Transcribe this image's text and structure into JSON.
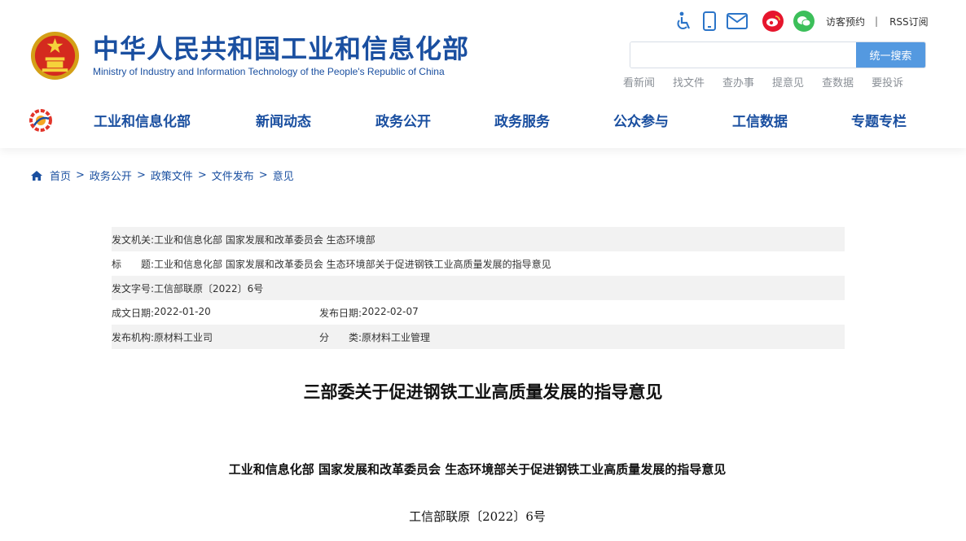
{
  "header": {
    "title": "中华人民共和国工业和信息化部",
    "subtitle": "Ministry of Industry and Information Technology of the People's Republic of China",
    "emblem_icon": "national-emblem-icon",
    "tools": {
      "accessibility_icon": "accessibility-icon",
      "mobile_icon": "mobile-icon",
      "mail_icon": "mail-icon",
      "weibo_icon": "weibo-icon",
      "wechat_icon": "wechat-icon",
      "visitor_label": "访客预约",
      "separator": "|",
      "rss_label": "RSS订阅"
    },
    "search": {
      "placeholder": "",
      "value": "",
      "button_label": "统一搜索"
    },
    "quick_links": [
      "看新闻",
      "找文件",
      "查办事",
      "提意见",
      "查数据",
      "要投诉"
    ],
    "colors": {
      "brand": "#1a4fa0",
      "search_button": "#5499e0",
      "weibo": "#e6162d",
      "wechat": "#3cbf5a",
      "icon_blue": "#2b74c8"
    }
  },
  "nav": {
    "logo_icon": "miit-logo-icon",
    "items": [
      "工业和信息化部",
      "新闻动态",
      "政务公开",
      "政务服务",
      "公众参与",
      "工信数据",
      "专题专栏"
    ]
  },
  "breadcrumb": {
    "home_icon": "home-icon",
    "items": [
      "首页",
      "政务公开",
      "政策文件",
      "文件发布",
      "意见"
    ],
    "separator": ">"
  },
  "meta": {
    "issuer_label": "发文机关:",
    "issuer": "工业和信息化部 国家发展和改革委员会 生态环境部",
    "title_label": "标　　题:",
    "title": "工业和信息化部 国家发展和改革委员会 生态环境部关于促进钢铁工业高质量发展的指导意见",
    "doc_no_label": "发文字号:",
    "doc_no": "工信部联原〔2022〕6号",
    "created_label": "成文日期:",
    "created": "2022-01-20",
    "published_label": "发布日期:",
    "published": "2022-02-07",
    "org_label": "发布机构:",
    "org": "原材料工业司",
    "category_label": "分　　类:",
    "category": "原材料工业管理"
  },
  "article": {
    "title": "三部委关于促进钢铁工业高质量发展的指导意见",
    "subtitle": "工业和信息化部 国家发展和改革委员会 生态环境部关于促进钢铁工业高质量发展的指导意见",
    "doc_number": "工信部联原〔2022〕6号"
  }
}
